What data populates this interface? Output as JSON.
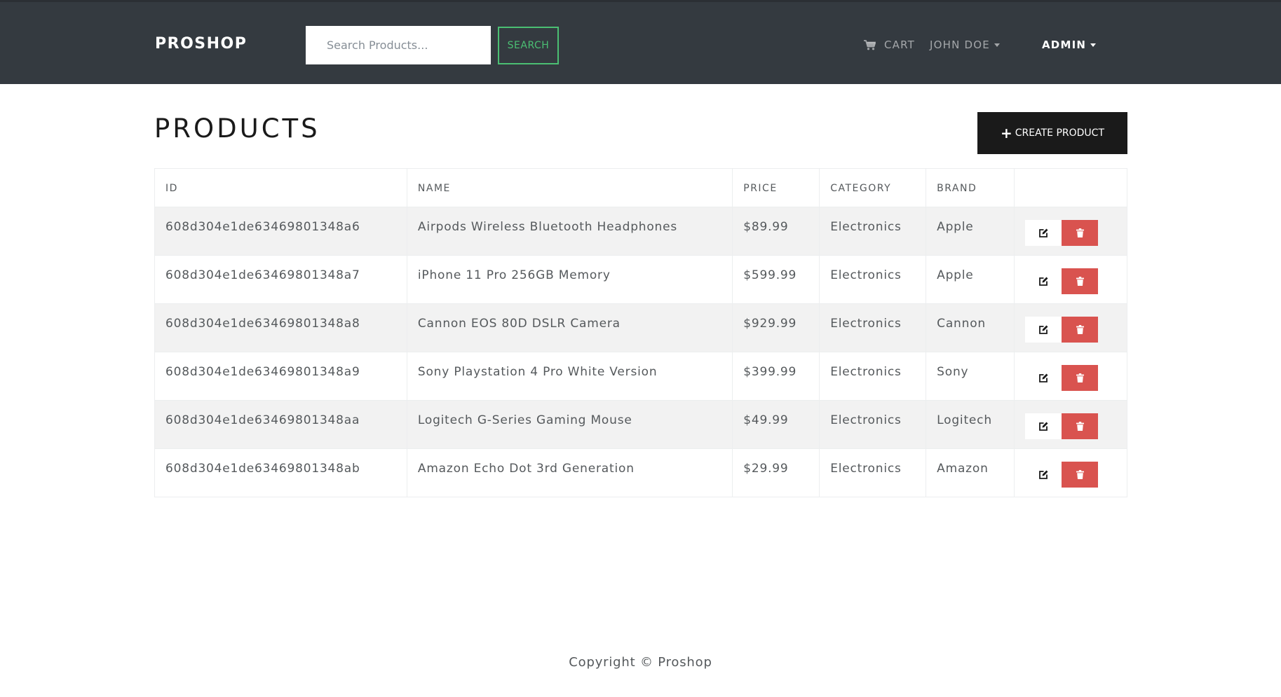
{
  "header": {
    "brand": "PROSHOP",
    "search_placeholder": "Search Products...",
    "search_button": "SEARCH",
    "cart_label": "CART",
    "user_label": "JOHN DOE",
    "admin_label": "ADMIN"
  },
  "main": {
    "title": "PRODUCTS",
    "create_button": "CREATE PRODUCT",
    "table": {
      "columns": [
        "ID",
        "NAME",
        "PRICE",
        "CATEGORY",
        "BRAND",
        ""
      ],
      "rows": [
        {
          "id": "608d304e1de63469801348a6",
          "name": "Airpods Wireless Bluetooth Headphones",
          "price": "$89.99",
          "category": "Electronics",
          "brand": "Apple"
        },
        {
          "id": "608d304e1de63469801348a7",
          "name": "iPhone 11 Pro 256GB Memory",
          "price": "$599.99",
          "category": "Electronics",
          "brand": "Apple"
        },
        {
          "id": "608d304e1de63469801348a8",
          "name": "Cannon EOS 80D DSLR Camera",
          "price": "$929.99",
          "category": "Electronics",
          "brand": "Cannon"
        },
        {
          "id": "608d304e1de63469801348a9",
          "name": "Sony Playstation 4 Pro White Version",
          "price": "$399.99",
          "category": "Electronics",
          "brand": "Sony"
        },
        {
          "id": "608d304e1de63469801348aa",
          "name": "Logitech G-Series Gaming Mouse",
          "price": "$49.99",
          "category": "Electronics",
          "brand": "Logitech"
        },
        {
          "id": "608d304e1de63469801348ab",
          "name": "Amazon Echo Dot 3rd Generation",
          "price": "$29.99",
          "category": "Electronics",
          "brand": "Amazon"
        }
      ]
    }
  },
  "footer": {
    "copyright": "Copyright © Proshop"
  },
  "colors": {
    "navbar": "#343a40",
    "success": "#4bbf73",
    "danger": "#d9534f",
    "primary_dark": "#1a1a1a"
  },
  "icons": {
    "cart": "cart-icon",
    "edit": "edit-icon",
    "delete": "trash-icon",
    "create": "plus-icon"
  }
}
